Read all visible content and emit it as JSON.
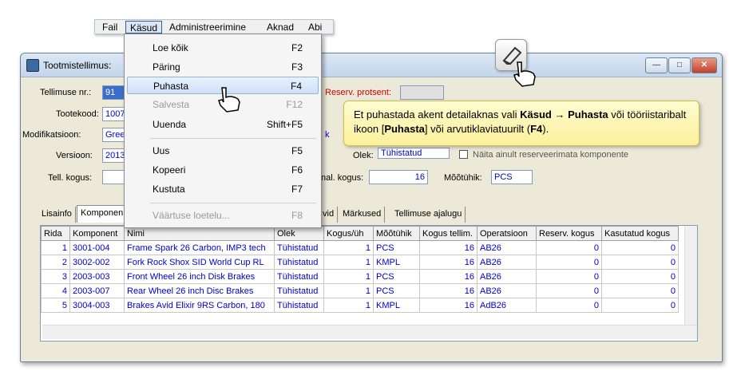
{
  "window": {
    "title": "Tootmistellimus:",
    "buttons": {
      "minimize": "—",
      "maximize": "□",
      "close": "✕"
    }
  },
  "menubar": {
    "items": [
      "Fail",
      "Käsud",
      "Administreerimine",
      "Aknad",
      "Abi"
    ]
  },
  "dropdown": {
    "items": [
      {
        "label": "Loe kõik",
        "key": "F2"
      },
      {
        "label": "Päring",
        "key": "F3"
      },
      {
        "label": "Puhasta",
        "key": "F4"
      },
      {
        "label": "Salvesta",
        "key": "F12"
      },
      {
        "label": "Uuenda",
        "key": "Shift+F5"
      },
      {
        "label": "Uus",
        "key": "F5"
      },
      {
        "label": "Kopeeri",
        "key": "F6"
      },
      {
        "label": "Kustuta",
        "key": "F7"
      },
      {
        "label": "Väärtuse loetelu...",
        "key": "F8"
      }
    ]
  },
  "form": {
    "tellimuse_nr_label": "Tellimuse nr.:",
    "tellimuse_nr_value": "91",
    "tootekood_label": "Tootekood:",
    "tootekood_value": "1007",
    "modifikatsioon_label": "Modifikatsioon:",
    "modifikatsioon_value": "Gree",
    "versioon_label": "Versioon:",
    "versioon_value": "2013",
    "tell_kogus_label": "Tell. kogus:",
    "tell_kogus_value": "",
    "reserv_label": "Reserv. protsent:",
    "k_fragment": "k",
    "olek_label": "Olek:",
    "olek_value": "Tühistatud",
    "naita_label": "Näita ainult reserveerimata komponente",
    "nal_kogus_label": "nal. kogus:",
    "nal_kogus_value": "16",
    "mootuhik_label": "Mõõtühik:",
    "mootuhik_value": "PCS"
  },
  "tabs": [
    "Lisainfo",
    "Komponen",
    "vid",
    "Märkused",
    "Tellimuse ajalugu"
  ],
  "grid": {
    "columns": [
      "Rida",
      "Komponent",
      "Nimi",
      "Olek",
      "Kogus/üh",
      "Mõõtühik",
      "Kogus tellim.",
      "Operatsioon",
      "Reserv. kogus",
      "Kasutatud kogus"
    ],
    "rows": [
      [
        "1",
        "3001-004",
        "Frame Spark 26 Carbon, IMP3 tech",
        "Tühistatud",
        "1",
        "PCS",
        "16",
        "AB26",
        "0",
        "0"
      ],
      [
        "2",
        "3002-002",
        "Fork Rock Shox SID World Cup RL",
        "Tühistatud",
        "1",
        "KMPL",
        "16",
        "AB26",
        "0",
        "0"
      ],
      [
        "3",
        "2003-003",
        "Front Wheel 26 inch Disk Brakes",
        "Tühistatud",
        "1",
        "PCS",
        "16",
        "AB26",
        "0",
        "0"
      ],
      [
        "4",
        "2003-007",
        "Rear Wheel 26 inch Disc Brakes",
        "Tühistatud",
        "1",
        "PCS",
        "16",
        "AB26",
        "0",
        "0"
      ],
      [
        "5",
        "3004-003",
        "Brakes Avid Elixir 9RS Carbon, 180",
        "Tühistatud",
        "1",
        "KMPL",
        "16",
        "AdB26",
        "0",
        "0"
      ]
    ]
  },
  "callout": {
    "t1": "Et puhastada akent detailaknas vali ",
    "b1": "Käsud → Puhasta",
    "t2": " või tööriistaribalt ikoon [",
    "b2": "Puhasta",
    "t3": "] või arvutiklaviatuurilt (",
    "b3": "F4",
    "t4": ")."
  },
  "colors": {
    "accent": "#3b6ec9",
    "callout_bg": "#fdf6b3",
    "link_text": "#0000cc"
  }
}
